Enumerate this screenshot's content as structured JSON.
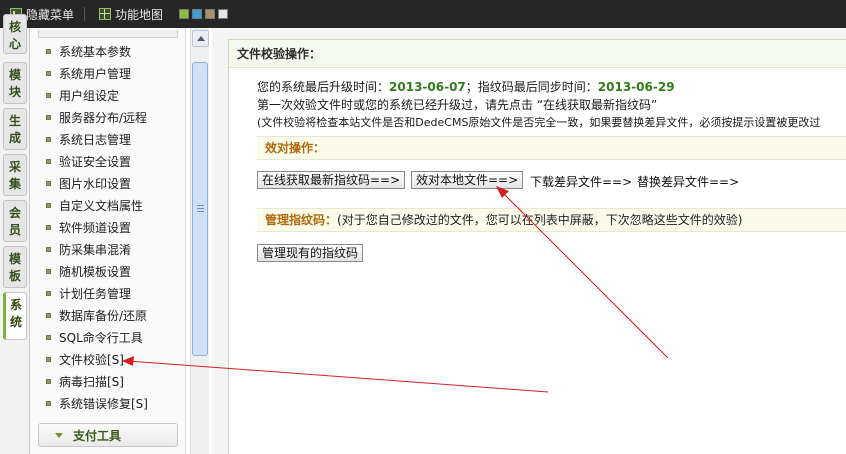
{
  "toolbar": {
    "hide_menu": "隐藏菜单",
    "site_map": "功能地图",
    "swatches": [
      "#8bbf3c",
      "#3aa0d8",
      "#a8946a",
      "#e6e6e6"
    ]
  },
  "vertical_tabs": [
    {
      "label": "核心"
    },
    {
      "label": "模块"
    },
    {
      "label": "生成"
    },
    {
      "label": "采集"
    },
    {
      "label": "会员"
    },
    {
      "label": "模板"
    },
    {
      "label": "系统"
    }
  ],
  "sidebar": {
    "items": [
      {
        "label": "系统基本参数"
      },
      {
        "label": "系统用户管理"
      },
      {
        "label": "用户组设定"
      },
      {
        "label": "服务器分布/远程"
      },
      {
        "label": "系统日志管理"
      },
      {
        "label": "验证安全设置"
      },
      {
        "label": "图片水印设置"
      },
      {
        "label": "自定义文档属性"
      },
      {
        "label": "软件频道设置"
      },
      {
        "label": "防采集串混淆"
      },
      {
        "label": "随机模板设置"
      },
      {
        "label": "计划任务管理"
      },
      {
        "label": "数据库备份/还原"
      },
      {
        "label": "SQL命令行工具"
      },
      {
        "label": "文件校验[S]"
      },
      {
        "label": "病毒扫描[S]"
      },
      {
        "label": "系统错误修复[S]"
      }
    ],
    "footer": "支付工具"
  },
  "main": {
    "title": "文件校验操作：",
    "line1_prefix": "您的系统最后升级时间：",
    "upgrade_date": "2013-06-07",
    "line1_mid": "；指纹码最后同步时间：",
    "sync_date": "2013-06-29",
    "line2": "第一次效验文件时或您的系统已经升级过，请先点击 “在线获取最新指纹码”",
    "line3": "(文件校验将检查本站文件是否和DedeCMS原始文件是否完全一致，如果要替换差异文件，必须按提示设置被更改过",
    "verify_heading": "效对操作：",
    "btn_fetch": "在线获取最新指纹码==>",
    "btn_verify": "效对本地文件==>",
    "link_download": "下载差异文件==>",
    "link_replace": "替换差异文件==>",
    "manage_heading": "管理指纹码：",
    "manage_desc": "(对于您自己修改过的文件，您可以在列表中屏蔽，下次忽略这些文件的效验)",
    "btn_manage": "管理现有的指纹码"
  }
}
